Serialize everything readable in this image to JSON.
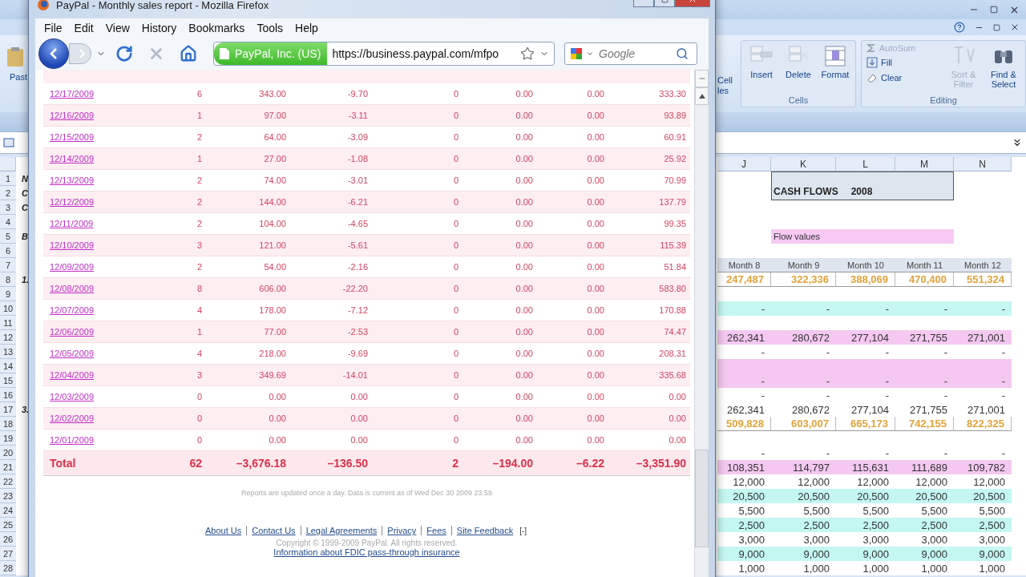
{
  "excel": {
    "paste_label": "Past",
    "styles_fragments": [
      "Cell",
      "les"
    ],
    "cells_group": {
      "label": "Cells",
      "buttons": [
        {
          "label": "Insert",
          "kind": "insert"
        },
        {
          "label": "Delete",
          "kind": "delete"
        },
        {
          "label": "Format",
          "kind": "format"
        }
      ]
    },
    "editing_group": {
      "label": "Editing",
      "small_buttons": [
        {
          "label": "AutoSum",
          "kind": "sum",
          "disabled": true
        },
        {
          "label": "Fill",
          "kind": "fill",
          "disabled": false
        },
        {
          "label": "Clear",
          "kind": "clear",
          "disabled": false
        }
      ],
      "large_buttons": [
        {
          "label": "Sort & Filter",
          "kind": "sort",
          "disabled": true
        },
        {
          "label": "Find & Select",
          "kind": "find",
          "disabled": false
        }
      ]
    },
    "columns": [
      "J",
      "K",
      "L",
      "M",
      "N"
    ],
    "rows": [
      {
        "number": "1",
        "fragment": "N",
        "kind": "title_top",
        "cells": []
      },
      {
        "number": "2",
        "fragment": "C",
        "kind": "title",
        "cells": [
          "",
          "CASH FLOWS",
          "2008"
        ]
      },
      {
        "number": "3",
        "fragment": "C",
        "kind": "blank",
        "cells": []
      },
      {
        "number": "4",
        "kind": "blank",
        "cells": []
      },
      {
        "number": "5",
        "fragment": "B",
        "kind": "label",
        "cells": [
          "",
          "Flow values"
        ]
      },
      {
        "number": "6",
        "kind": "blank",
        "cells": []
      },
      {
        "number": "7",
        "kind": "header",
        "cells": [
          "Month 8",
          "Month 9",
          "Month 10",
          "Month 11",
          "Month 12"
        ]
      },
      {
        "number": "8",
        "fragment": "1.",
        "kind": "orange",
        "cells": [
          "247,487",
          "322,336",
          "388,069",
          "470,400",
          "551,324"
        ]
      },
      {
        "number": "9",
        "kind": "blank",
        "cells": []
      },
      {
        "number": "10",
        "kind": "cyan",
        "cells": [
          "-",
          "-",
          "-",
          "-",
          "-"
        ]
      },
      {
        "number": "11",
        "kind": "blank",
        "cells": []
      },
      {
        "number": "12",
        "kind": "pink",
        "cells": [
          "262,341",
          "280,672",
          "277,104",
          "271,755",
          "271,001"
        ]
      },
      {
        "number": "13",
        "kind": "plain",
        "cells": [
          "-",
          "-",
          "-",
          "-",
          "-"
        ]
      },
      {
        "number": "14",
        "kind": "pink",
        "cells": []
      },
      {
        "number": "15",
        "kind": "pink",
        "cells": [
          "-",
          "-",
          "-",
          "-",
          "-"
        ]
      },
      {
        "number": "16",
        "kind": "plain",
        "cells": [
          "-",
          "-",
          "-",
          "-",
          "-"
        ]
      },
      {
        "number": "17",
        "fragment": "3.",
        "kind": "plain",
        "cells": [
          "262,341",
          "280,672",
          "277,104",
          "271,755",
          "271,001"
        ]
      },
      {
        "number": "18",
        "kind": "orange",
        "cells": [
          "509,828",
          "603,007",
          "665,173",
          "742,155",
          "822,325"
        ]
      },
      {
        "number": "19",
        "kind": "blank",
        "cells": []
      },
      {
        "number": "20",
        "kind": "plain",
        "cells": [
          "-",
          "-",
          "-",
          "-",
          "-"
        ]
      },
      {
        "number": "21",
        "kind": "pink",
        "cells": [
          "108,351",
          "114,797",
          "115,631",
          "111,689",
          "109,782"
        ]
      },
      {
        "number": "22",
        "kind": "plain",
        "cells": [
          "12,000",
          "12,000",
          "12,000",
          "12,000",
          "12,000"
        ]
      },
      {
        "number": "23",
        "kind": "cyan",
        "cells": [
          "20,500",
          "20,500",
          "20,500",
          "20,500",
          "20,500"
        ]
      },
      {
        "number": "24",
        "kind": "plain",
        "cells": [
          "5,500",
          "5,500",
          "5,500",
          "5,500",
          "5,500"
        ]
      },
      {
        "number": "25",
        "kind": "cyan",
        "cells": [
          "2,500",
          "2,500",
          "2,500",
          "2,500",
          "2,500"
        ]
      },
      {
        "number": "26",
        "kind": "plain",
        "cells": [
          "3,000",
          "3,000",
          "3,000",
          "3,000",
          "3,000"
        ]
      },
      {
        "number": "27",
        "kind": "cyan",
        "cells": [
          "9,000",
          "9,000",
          "9,000",
          "9,000",
          "9,000"
        ]
      },
      {
        "number": "28",
        "kind": "plain",
        "cells": [
          "1,000",
          "1,000",
          "1,000",
          "1,000",
          "1,000"
        ]
      }
    ]
  },
  "browser": {
    "title": "PayPal - Monthly sales report - Mozilla Firefox",
    "menu": [
      "File",
      "Edit",
      "View",
      "History",
      "Bookmarks",
      "Tools",
      "Help"
    ],
    "nav": [
      {
        "kind": "back",
        "disabled": false
      },
      {
        "kind": "forward",
        "disabled": true
      },
      {
        "kind": "reload",
        "disabled": false
      },
      {
        "kind": "stop",
        "disabled": true
      },
      {
        "kind": "home",
        "disabled": false
      }
    ],
    "identity": "PayPal, Inc. (US)",
    "url": "https://business.paypal.com/mfpo",
    "search": {
      "placeholder": "Google"
    },
    "table": {
      "rows": [
        {
          "date": "12/17/2009",
          "values": [
            "6",
            "343.00",
            "-9.70",
            "0",
            "0.00",
            "0.00",
            "333.30"
          ]
        },
        {
          "date": "12/16/2009",
          "values": [
            "1",
            "97.00",
            "-3.11",
            "0",
            "0.00",
            "0.00",
            "93.89"
          ]
        },
        {
          "date": "12/15/2009",
          "values": [
            "2",
            "64.00",
            "-3.09",
            "0",
            "0.00",
            "0.00",
            "60.91"
          ]
        },
        {
          "date": "12/14/2009",
          "values": [
            "1",
            "27.00",
            "-1.08",
            "0",
            "0.00",
            "0.00",
            "25.92"
          ]
        },
        {
          "date": "12/13/2009",
          "values": [
            "2",
            "74.00",
            "-3.01",
            "0",
            "0.00",
            "0.00",
            "70.99"
          ]
        },
        {
          "date": "12/12/2009",
          "values": [
            "2",
            "144.00",
            "-6.21",
            "0",
            "0.00",
            "0.00",
            "137.79"
          ]
        },
        {
          "date": "12/11/2009",
          "values": [
            "2",
            "104.00",
            "-4.65",
            "0",
            "0.00",
            "0.00",
            "99.35"
          ]
        },
        {
          "date": "12/10/2009",
          "values": [
            "3",
            "121.00",
            "-5.61",
            "0",
            "0.00",
            "0.00",
            "115.39"
          ]
        },
        {
          "date": "12/09/2009",
          "values": [
            "2",
            "54.00",
            "-2.16",
            "0",
            "0.00",
            "0.00",
            "51.84"
          ]
        },
        {
          "date": "12/08/2009",
          "values": [
            "8",
            "606.00",
            "-22.20",
            "0",
            "0.00",
            "0.00",
            "583.80"
          ]
        },
        {
          "date": "12/07/2009",
          "values": [
            "4",
            "178.00",
            "-7.12",
            "0",
            "0.00",
            "0.00",
            "170.88"
          ]
        },
        {
          "date": "12/06/2009",
          "values": [
            "1",
            "77.00",
            "-2.53",
            "0",
            "0.00",
            "0.00",
            "74.47"
          ]
        },
        {
          "date": "12/05/2009",
          "values": [
            "4",
            "218.00",
            "-9.69",
            "0",
            "0.00",
            "0.00",
            "208.31"
          ]
        },
        {
          "date": "12/04/2009",
          "values": [
            "3",
            "349.69",
            "-14.01",
            "0",
            "0.00",
            "0.00",
            "335.68"
          ]
        },
        {
          "date": "12/03/2009",
          "values": [
            "0",
            "0.00",
            "0.00",
            "0",
            "0.00",
            "0.00",
            "0.00"
          ]
        },
        {
          "date": "12/02/2009",
          "values": [
            "0",
            "0.00",
            "0.00",
            "0",
            "0.00",
            "0.00",
            "0.00"
          ]
        },
        {
          "date": "12/01/2009",
          "values": [
            "0",
            "0.00",
            "0.00",
            "0",
            "0.00",
            "0.00",
            "0.00"
          ]
        }
      ],
      "total": {
        "label": "Total",
        "values": [
          "62",
          "–3,676.18",
          "–136.50",
          "2",
          "–194.00",
          "–6.22",
          "–3,351.90"
        ]
      }
    },
    "note": "Reports are updated once a day. Data is current as of Wed Dec 30 2009 23:59",
    "footer_links": [
      "About Us",
      "Contact Us",
      "Legal Agreements",
      "Privacy",
      "Fees",
      "Site Feedback"
    ],
    "collapse_toggle": "[-]",
    "copyright": "Copyright © 1999-2009 PayPal. All rights reserved.",
    "fdic_link": "Information about FDIC pass-through insurance"
  }
}
